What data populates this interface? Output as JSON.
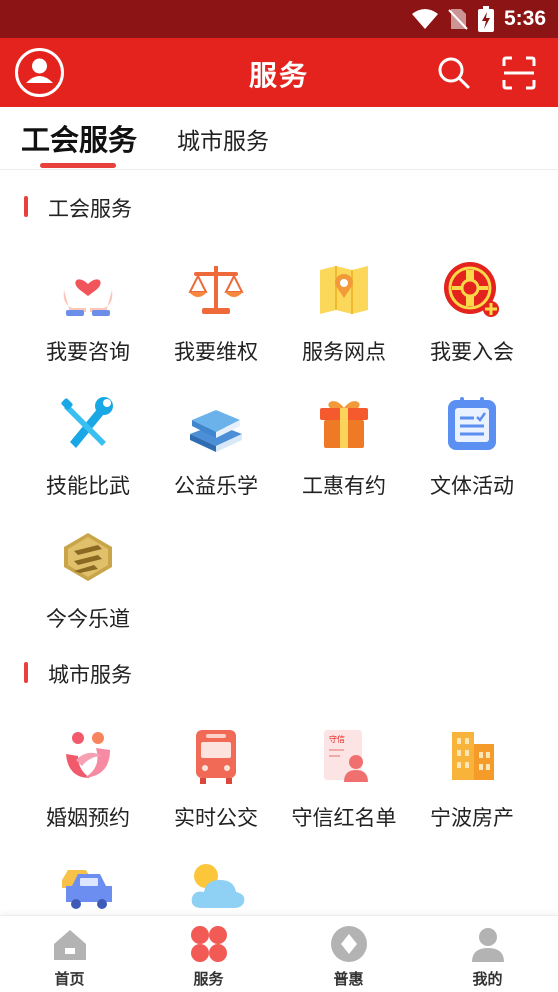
{
  "status_bar": {
    "time": "5:36"
  },
  "header": {
    "title": "服务"
  },
  "tabs": [
    {
      "label": "工会服务",
      "active": true
    },
    {
      "label": "城市服务",
      "active": false
    }
  ],
  "sections": [
    {
      "title": "工会服务",
      "items": [
        {
          "label": "我要咨询",
          "icon": "hands-heart-icon"
        },
        {
          "label": "我要维权",
          "icon": "scales-icon"
        },
        {
          "label": "服务网点",
          "icon": "map-pin-icon"
        },
        {
          "label": "我要入会",
          "icon": "union-emblem-icon"
        },
        {
          "label": "技能比武",
          "icon": "tools-icon"
        },
        {
          "label": "公益乐学",
          "icon": "books-icon"
        },
        {
          "label": "工惠有约",
          "icon": "gift-icon"
        },
        {
          "label": "文体活动",
          "icon": "notepad-icon"
        },
        {
          "label": "今今乐道",
          "icon": "gold-logo-icon"
        }
      ]
    },
    {
      "title": "城市服务",
      "items": [
        {
          "label": "婚姻预约",
          "icon": "marriage-icon"
        },
        {
          "label": "实时公交",
          "icon": "bus-icon"
        },
        {
          "label": "守信红名单",
          "icon": "certificate-icon"
        },
        {
          "label": "宁波房产",
          "icon": "buildings-icon"
        },
        {
          "label": "",
          "icon": "cars-icon"
        },
        {
          "label": "",
          "icon": "weather-icon"
        }
      ]
    }
  ],
  "certificate_tag": "守信",
  "bottom_nav": [
    {
      "label": "首页",
      "icon": "home-icon",
      "active": false
    },
    {
      "label": "服务",
      "icon": "service-icon",
      "active": true
    },
    {
      "label": "普惠",
      "icon": "benefit-icon",
      "active": false
    },
    {
      "label": "我的",
      "icon": "profile-icon",
      "active": false
    }
  ],
  "colors": {
    "brand_red": "#e4231e",
    "status_dark_red": "#8c1414",
    "accent": "#e8403b"
  }
}
